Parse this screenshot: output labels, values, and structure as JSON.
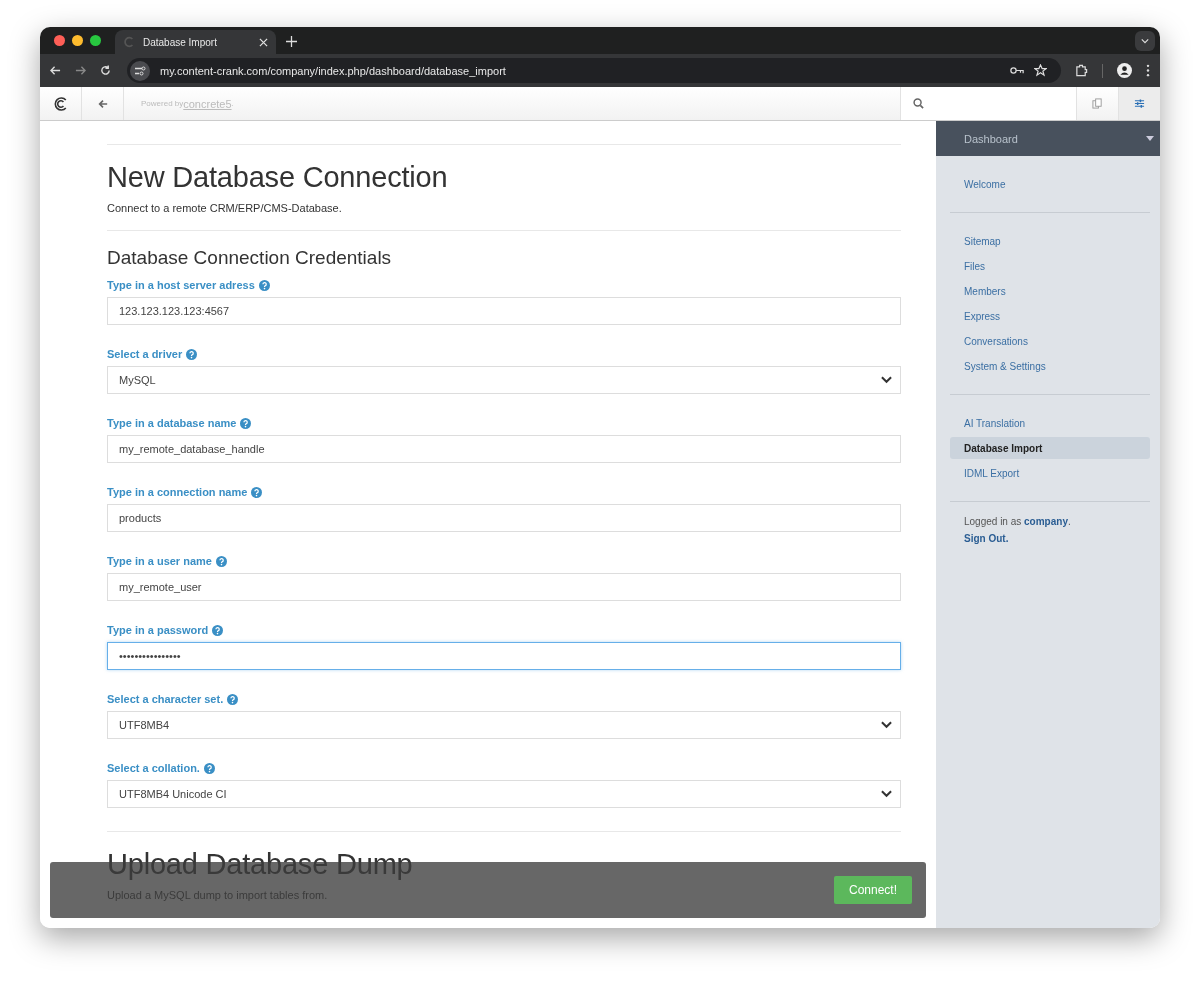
{
  "browser": {
    "tab_title": "Database Import",
    "url": "my.content-crank.com/company/index.php/dashboard/database_import"
  },
  "header": {
    "powered_by": "Powered by ",
    "brand_link": "concrete5",
    "brand_suffix": "."
  },
  "page": {
    "title": "New Database Connection",
    "subtitle": "Connect to a remote CRM/ERP/CMS-Database.",
    "section_title": "Database Connection Credentials",
    "fields": [
      {
        "label": "Type in a host server adress",
        "kind": "text",
        "value": "123.123.123.123:4567",
        "focused": false
      },
      {
        "label": "Select a driver",
        "kind": "select",
        "value": "MySQL",
        "focused": false
      },
      {
        "label": "Type in a database name",
        "kind": "text",
        "value": "my_remote_database_handle",
        "focused": false
      },
      {
        "label": "Type in a connection name",
        "kind": "text",
        "value": "products",
        "focused": false
      },
      {
        "label": "Type in a user name",
        "kind": "text",
        "value": "my_remote_user",
        "focused": false
      },
      {
        "label": "Type in a password",
        "kind": "password",
        "value": "••••••••••••••••",
        "focused": true
      },
      {
        "label": "Select a character set.",
        "kind": "select",
        "value": "UTF8MB4",
        "focused": false
      },
      {
        "label": "Select a collation.",
        "kind": "select",
        "value": "UTF8MB4 Unicode CI",
        "focused": false
      }
    ],
    "upload_title": "Upload Database Dump",
    "upload_subtitle": "Upload a MySQL dump to import tables from."
  },
  "action_bar": {
    "button": "Connect!"
  },
  "sidebar": {
    "title": "Dashboard",
    "groups": [
      [
        {
          "label": "Welcome",
          "selected": false
        }
      ],
      [
        {
          "label": "Sitemap",
          "selected": false
        },
        {
          "label": "Files",
          "selected": false
        },
        {
          "label": "Members",
          "selected": false
        },
        {
          "label": "Express",
          "selected": false
        },
        {
          "label": "Conversations",
          "selected": false
        },
        {
          "label": "System & Settings",
          "selected": false
        }
      ],
      [
        {
          "label": "AI Translation",
          "selected": false
        },
        {
          "label": "Database Import",
          "selected": true
        },
        {
          "label": "IDML Export",
          "selected": false
        }
      ]
    ],
    "logged_in_prefix": "Logged in as ",
    "user": "company",
    "logged_in_suffix": ".",
    "sign_out": "Sign Out."
  }
}
